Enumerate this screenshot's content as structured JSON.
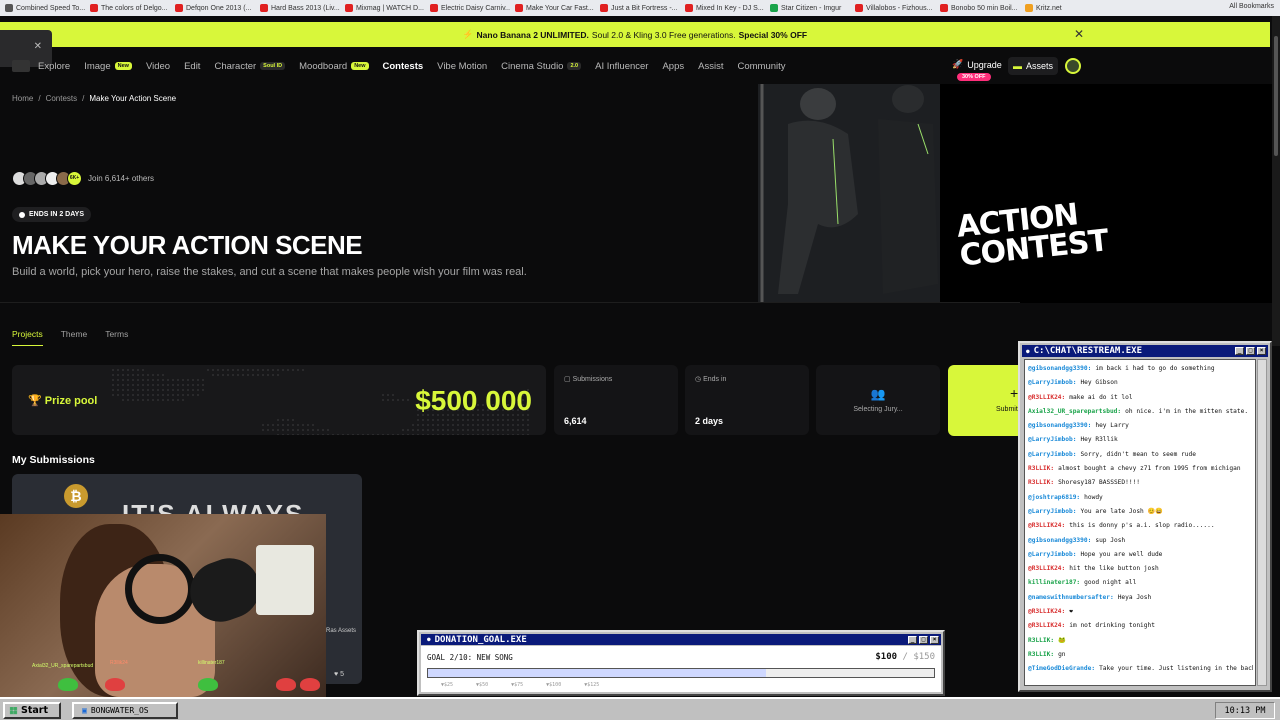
{
  "bookmarks": [
    {
      "label": "Combined Speed To...",
      "color": "#555555"
    },
    {
      "label": "The colors of Delgo...",
      "color": "#e02020"
    },
    {
      "label": "Defqon One 2013 (...",
      "color": "#e02020"
    },
    {
      "label": "Hard Bass 2013 (Liv...",
      "color": "#e02020"
    },
    {
      "label": "Mixmag | WATCH D...",
      "color": "#e02020"
    },
    {
      "label": "Electric Daisy Carniv...",
      "color": "#e02020"
    },
    {
      "label": "Make Your Car Fast...",
      "color": "#e02020"
    },
    {
      "label": "Just a Bit Fortress -...",
      "color": "#e02020"
    },
    {
      "label": "Mixed In Key - DJ S...",
      "color": "#e02020"
    },
    {
      "label": "Star Citizen - Imgur",
      "color": "#1aa34a"
    },
    {
      "label": "Villalobos - Fizhous...",
      "color": "#e02020"
    },
    {
      "label": "Bonobo 50 min Boil...",
      "color": "#e02020"
    },
    {
      "label": "Kritz.net",
      "color": "#f0a020"
    }
  ],
  "all_bookmarks": "All Bookmarks",
  "promo": {
    "brand": "Nano Banana 2 UNLIMITED.",
    "text": "Soul 2.0 & Kling 3.0 Free generations.",
    "special": "Special 30% OFF"
  },
  "nav": [
    {
      "label": "Explore",
      "tag": ""
    },
    {
      "label": "Image",
      "tag": "New"
    },
    {
      "label": "Video",
      "tag": ""
    },
    {
      "label": "Edit",
      "tag": ""
    },
    {
      "label": "Character",
      "tag": "Soul ID"
    },
    {
      "label": "Moodboard",
      "tag": "New"
    },
    {
      "label": "Contests",
      "tag": ""
    },
    {
      "label": "Vibe Motion",
      "tag": ""
    },
    {
      "label": "Cinema Studio",
      "tag": "2.0"
    },
    {
      "label": "AI Influencer",
      "tag": ""
    },
    {
      "label": "Apps",
      "tag": ""
    },
    {
      "label": "Assist",
      "tag": ""
    },
    {
      "label": "Community",
      "tag": ""
    }
  ],
  "upgrade": "Upgrade",
  "upgrade_badge": "30% OFF",
  "assets": "Assets",
  "breadcrumb": [
    "Home",
    "Contests",
    "Make Your Action Scene"
  ],
  "joined": "Join 6,614+ others",
  "avatar_badge": "6K+",
  "ends_badge": "ENDS IN 2 DAYS",
  "hero_title": "MAKE YOUR ACTION SCENE",
  "hero_subtitle": "Build a world, pick your hero, raise the stakes, and cut a scene that makes people wish your film was real.",
  "hero_logo": [
    "ACTION",
    "CONTEST"
  ],
  "tabs": [
    "Projects",
    "Theme",
    "Terms"
  ],
  "prize": {
    "label": "Prize pool",
    "value": "$500 000"
  },
  "stats": [
    {
      "label": "Submissions",
      "value": "6,614"
    },
    {
      "label": "Ends in",
      "value": "2 days"
    }
  ],
  "jury": "Selecting Jury...",
  "submit": "Submit",
  "my_submissions": "My Submissions",
  "thumb_text": "IT'S ALWAYS",
  "thumb_caption": "Ras Assets",
  "thumb_likes": "5",
  "cam_names": [
    "Axial32_UR_sparepartsbud",
    "R3llik24",
    "killinater187"
  ],
  "chat": {
    "title": "C:\\CHAT\\RESTREAM.EXE",
    "messages": [
      {
        "user": "@gibsonandgg3390:",
        "text": "im back i had to go do something",
        "color": "#1a8ad8"
      },
      {
        "user": "@LarryJimbob:",
        "text": "Hey Gibson",
        "color": "#1a8ad8"
      },
      {
        "user": "@R3LLIK24:",
        "text": "make ai do it lol",
        "color": "#d83030"
      },
      {
        "user": "Axial32_UR_sparepartsbud:",
        "text": "oh nice. i'm in the mitten state.",
        "color": "#1aa34a"
      },
      {
        "user": "@gibsonandgg3390:",
        "text": "hey Larry",
        "color": "#1a8ad8"
      },
      {
        "user": "@LarryJimbob:",
        "text": "Hey R3llik",
        "color": "#1a8ad8"
      },
      {
        "user": "@LarryJimbob:",
        "text": "Sorry, didn't mean to seem rude",
        "color": "#1a8ad8"
      },
      {
        "user": "R3LLIK:",
        "text": "almost bought a chevy z71 from 1995 from michigan",
        "color": "#d83030"
      },
      {
        "user": "R3LLIK:",
        "text": "Shoresy187 BASSSED!!!!",
        "color": "#d83030"
      },
      {
        "user": "@joshtrap6819:",
        "text": "howdy",
        "color": "#1a8ad8"
      },
      {
        "user": "@LarryJimbob:",
        "text": "You are late Josh 😊😄",
        "color": "#1a8ad8"
      },
      {
        "user": "@R3LLIK24:",
        "text": "this is donny p's a.i. slop radio......",
        "color": "#d83030"
      },
      {
        "user": "@gibsonandgg3390:",
        "text": "sup Josh",
        "color": "#1a8ad8"
      },
      {
        "user": "@LarryJimbob:",
        "text": "Hope you are well dude",
        "color": "#1a8ad8"
      },
      {
        "user": "@R3LLIK24:",
        "text": "hit the like button josh",
        "color": "#d83030"
      },
      {
        "user": "killinater187:",
        "text": "good night all",
        "color": "#1aa34a"
      },
      {
        "user": "@nameswithnumbersafter:",
        "text": "Heya Josh",
        "color": "#1a8ad8"
      },
      {
        "user": "@R3LLIK24:",
        "text": "❤",
        "color": "#d83030"
      },
      {
        "user": "@R3LLIK24:",
        "text": "im not drinking tonight",
        "color": "#d83030"
      },
      {
        "user": "R3LLIK:",
        "text": "🐸",
        "color": "#1aa34a"
      },
      {
        "user": "R3LLIK:",
        "text": "gn",
        "color": "#1aa34a"
      },
      {
        "user": "@TimeGodDieGrande:",
        "text": "Take your time. Just listening in the background for now cause I'm a little busy.",
        "color": "#1a8ad8"
      }
    ]
  },
  "donation": {
    "title": "DONATION_GOAL.EXE",
    "goal": "GOAL 2/10: NEW SONG",
    "current": "$100",
    "target": "/ $150",
    "progress": 0.667,
    "ticks": "▼$25 ▼$50 ▼$75 ▼$100 ▼$125"
  },
  "taskbar": {
    "start": "Start",
    "task": "BONGWATER_OS",
    "clock": "10:13 PM"
  }
}
